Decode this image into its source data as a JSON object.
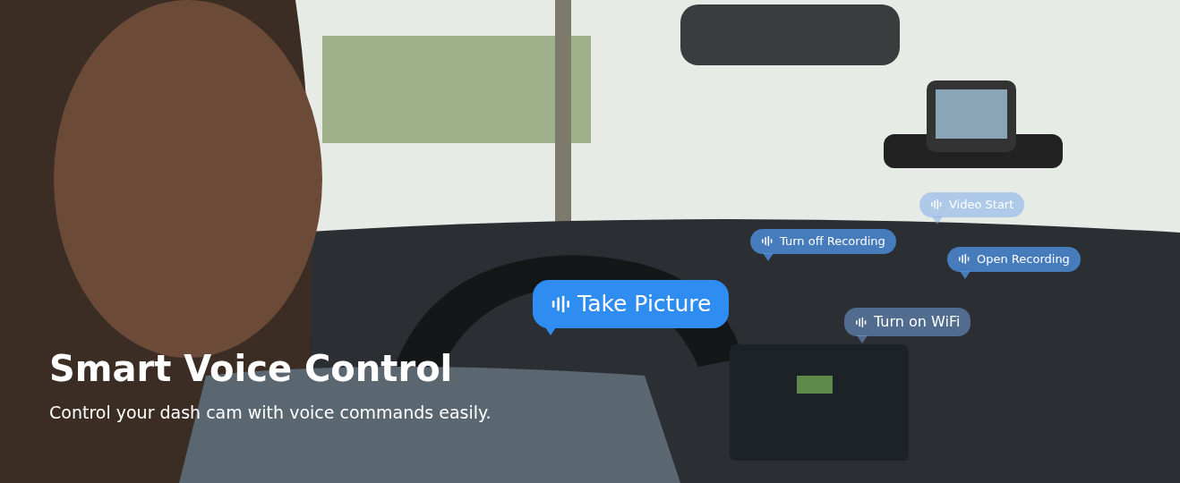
{
  "banner": {
    "title": "Smart Voice Control",
    "subtitle": "Control your dash cam with voice commands easily.",
    "bubbles": [
      {
        "label": "Video Start",
        "kind": "faint"
      },
      {
        "label": "Turn off Recording",
        "kind": "soft"
      },
      {
        "label": "Open Recording",
        "kind": "soft"
      },
      {
        "label": "Take Picture",
        "kind": "primary"
      },
      {
        "label": "Turn on WiFi",
        "kind": "faint"
      }
    ]
  }
}
